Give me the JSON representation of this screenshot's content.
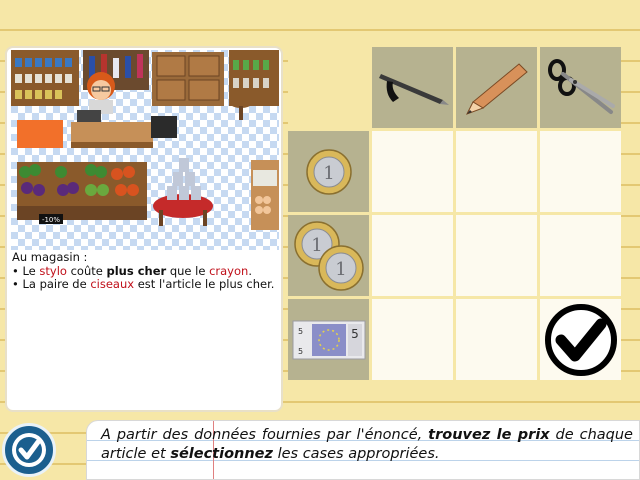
{
  "clue": {
    "intro": "Au magasin :",
    "line1": {
      "bullet": "• ",
      "a": "Le ",
      "kw1": "stylo",
      "b": " coûte ",
      "bold": "plus cher",
      "c": " que le ",
      "kw2": "crayon",
      "d": "."
    },
    "line2": {
      "bullet": "• ",
      "a": "La paire de ",
      "kw1": "ciseaux",
      "b": " est l'article le plus cher."
    }
  },
  "grid": {
    "columns": [
      {
        "item": "stylo",
        "icon": "pen-icon"
      },
      {
        "item": "crayon",
        "icon": "pencil-icon"
      },
      {
        "item": "ciseaux",
        "icon": "scissors-icon"
      }
    ],
    "rows": [
      {
        "price": "1 €",
        "icon": "one-euro-coin-icon"
      },
      {
        "price": "2 €",
        "icon": "two-one-euro-coins-icon"
      },
      {
        "price": "5 €",
        "icon": "five-euro-banknote-icon"
      }
    ],
    "coin_label": "1",
    "note_label": "5",
    "selected": [
      {
        "row": 2,
        "col": 2
      }
    ]
  },
  "instruction": {
    "a": "A partir des données fournies par l'énoncé, ",
    "b1": "trouvez le prix",
    "b": " de chaque article et ",
    "b2": "sélectionnez",
    "c": " les cases appropriées."
  },
  "shop_sign": "-10%",
  "colors": {
    "keyword": "#c0101a",
    "grid_header": "#b6b290",
    "background": "#f6e7a7",
    "check_button": "#1b5f8e"
  }
}
